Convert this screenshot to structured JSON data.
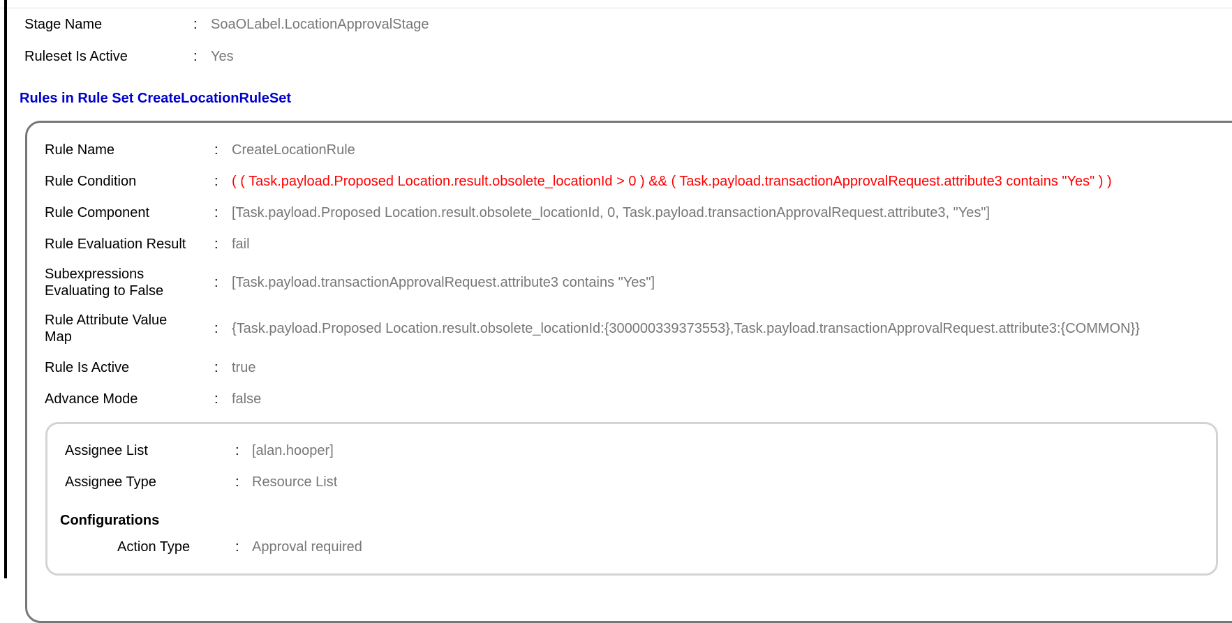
{
  "stage": {
    "name_label": "Stage Name",
    "name_value": "SoaOLabel.LocationApprovalStage",
    "active_label": "Ruleset Is Active",
    "active_value": "Yes"
  },
  "separator": ":",
  "ruleset_title": "Rules in Rule Set CreateLocationRuleSet",
  "rule": {
    "rows": [
      {
        "label": "Rule Name",
        "value": "CreateLocationRule"
      },
      {
        "label": "Rule Condition",
        "value": "( ( Task.payload.Proposed Location.result.obsolete_locationId > 0 ) && ( Task.payload.transactionApprovalRequest.attribute3 contains \"Yes\" ) )"
      },
      {
        "label": "Rule Component",
        "value": "[Task.payload.Proposed Location.result.obsolete_locationId, 0, Task.payload.transactionApprovalRequest.attribute3, \"Yes\"]"
      },
      {
        "label": "Rule Evaluation Result",
        "value": "fail"
      },
      {
        "label_line1": "Subexpressions",
        "label_line2": "Evaluating to False",
        "value": "[Task.payload.transactionApprovalRequest.attribute3 contains \"Yes\"]"
      },
      {
        "label_line1": "Rule Attribute Value",
        "label_line2": "Map",
        "value": "{Task.payload.Proposed Location.result.obsolete_locationId:{300000339373553},Task.payload.transactionApprovalRequest.attribute3:{COMMON}}"
      },
      {
        "label": "Rule Is Active",
        "value": "true"
      },
      {
        "label": "Advance Mode",
        "value": "false"
      }
    ]
  },
  "assignee": {
    "list_label": "Assignee List",
    "list_value": "[alan.hooper]",
    "type_label": "Assignee Type",
    "type_value": "Resource List"
  },
  "configurations": {
    "title": "Configurations",
    "action_type_label": "Action Type",
    "action_type_value": "Approval required"
  },
  "colors": {
    "title_blue": "#0000cc",
    "condition_red": "#ff0000",
    "value_gray": "#777777"
  }
}
